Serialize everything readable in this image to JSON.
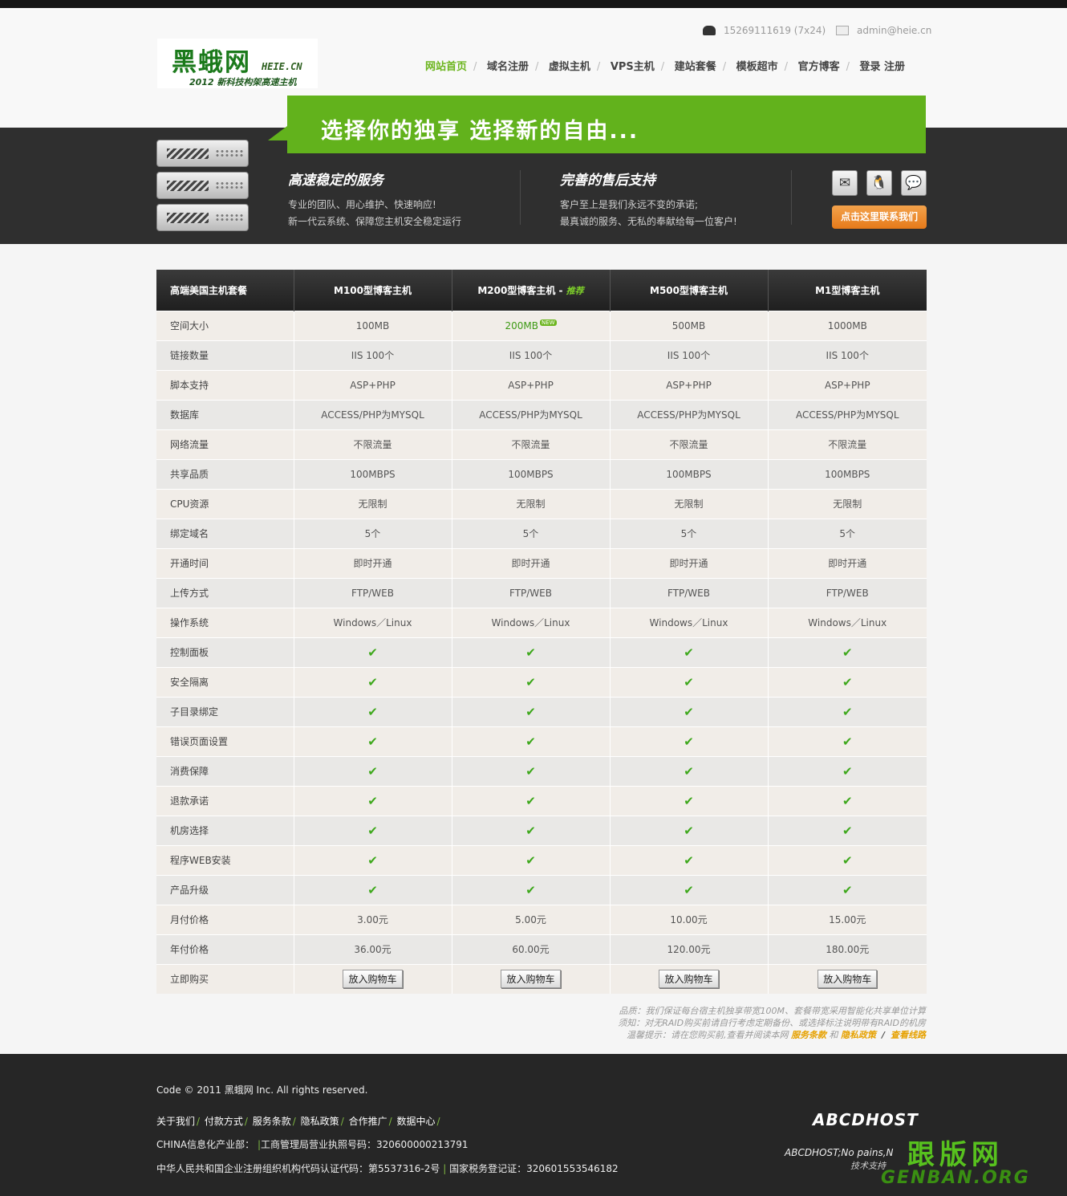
{
  "header": {
    "logo": {
      "title": "黑蛾网",
      "domain": "HEIE.CN",
      "tagline": "2012 新科技构架高速主机"
    },
    "phone": "15269111619 (7x24)",
    "email": "admin@heie.cn",
    "nav": [
      "网站首页",
      "域名注册",
      "虚拟主机",
      "VPS主机",
      "建站套餐",
      "模板超市",
      "官方博客",
      "登录 注册"
    ]
  },
  "banner": {
    "slogan": "选择你的独享 选择新的自由...",
    "features": [
      {
        "title": "高速稳定的服务",
        "lines": [
          "专业的团队、用心维护、快速响应!",
          "新一代云系统、保障您主机安全稳定运行"
        ]
      },
      {
        "title": "完善的售后支持",
        "lines": [
          "客户至上是我们永远不变的承诺;",
          "最真诚的服务、无私的奉献给每一位客户!"
        ]
      }
    ],
    "contact_button": "点击这里联系我们",
    "icons": [
      "mail-icon",
      "qq-icon",
      "chat-icon"
    ]
  },
  "table": {
    "headers": [
      "高端美国主机套餐",
      "M100型博客主机",
      "M200型博客主机",
      "M500型博客主机",
      "M1型博客主机"
    ],
    "recommend_tag": "推荐",
    "new_badge": "NEW",
    "rows": [
      [
        "空间大小",
        "100MB",
        "200MB",
        "500MB",
        "1000MB"
      ],
      [
        "链接数量",
        "IIS 100个",
        "IIS 100个",
        "IIS 100个",
        "IIS 100个"
      ],
      [
        "脚本支持",
        "ASP+PHP",
        "ASP+PHP",
        "ASP+PHP",
        "ASP+PHP"
      ],
      [
        "数据库",
        "ACCESS/PHP为MYSQL",
        "ACCESS/PHP为MYSQL",
        "ACCESS/PHP为MYSQL",
        "ACCESS/PHP为MYSQL"
      ],
      [
        "网络流量",
        "不限流量",
        "不限流量",
        "不限流量",
        "不限流量"
      ],
      [
        "共享品质",
        "100MBPS",
        "100MBPS",
        "100MBPS",
        "100MBPS"
      ],
      [
        "CPU资源",
        "无限制",
        "无限制",
        "无限制",
        "无限制"
      ],
      [
        "绑定域名",
        "5个",
        "5个",
        "5个",
        "5个"
      ],
      [
        "开通时间",
        "即时开通",
        "即时开通",
        "即时开通",
        "即时开通"
      ],
      [
        "上传方式",
        "FTP/WEB",
        "FTP/WEB",
        "FTP/WEB",
        "FTP/WEB"
      ],
      [
        "操作系统",
        "Windows／Linux",
        "Windows／Linux",
        "Windows／Linux",
        "Windows／Linux"
      ],
      [
        "控制面板",
        "✔",
        "✔",
        "✔",
        "✔"
      ],
      [
        "安全隔离",
        "✔",
        "✔",
        "✔",
        "✔"
      ],
      [
        "子目录绑定",
        "✔",
        "✔",
        "✔",
        "✔"
      ],
      [
        "错误页面设置",
        "✔",
        "✔",
        "✔",
        "✔"
      ],
      [
        "消费保障",
        "✔",
        "✔",
        "✔",
        "✔"
      ],
      [
        "退款承诺",
        "✔",
        "✔",
        "✔",
        "✔"
      ],
      [
        "机房选择",
        "✔",
        "✔",
        "✔",
        "✔"
      ],
      [
        "程序WEB安装",
        "✔",
        "✔",
        "✔",
        "✔"
      ],
      [
        "产品升级",
        "✔",
        "✔",
        "✔",
        "✔"
      ],
      [
        "月付价格",
        "3.00元",
        "5.00元",
        "10.00元",
        "15.00元"
      ],
      [
        "年付价格",
        "36.00元",
        "60.00元",
        "120.00元",
        "180.00元"
      ]
    ],
    "buy_label": "立即购买",
    "buy_button": "放入购物车"
  },
  "notes": {
    "line1": "品质：我们保证每台宿主机独享带宽100M、套餐带宽采用智能化共享单位计算",
    "line2": "须知：对无RAID购买前请自行考虑定期备份、或选择标注说明带有RAID的机房",
    "line3_prefix": "温馨提示：请在您购买前,查看并阅读本网",
    "link_terms": "服务条款",
    "and": "和",
    "link_privacy": "隐私政策",
    "slash": "/",
    "link_lines": "查看线路"
  },
  "footer": {
    "copyright": "Code © 2011 黑蛾网 Inc. All rights reserved.",
    "links": [
      "关于我们",
      "付款方式",
      "服务条款",
      "隐私政策",
      "合作推广",
      "数据中心"
    ],
    "line_industry": "CHINA信息化产业部：",
    "line_license": "工商管理局营业执照号码：320600000213791",
    "line_org": "中华人民共和国企业注册组织机构代码认证代码：第5537316-2号",
    "line_tax": "国家税务登记证：320601553546182",
    "brand": "ABCDHOST",
    "brand_text": "ABCDHOST;No pains,N",
    "brand_sub": "技术支持",
    "watermark": "跟版网",
    "watermark_domain": "GENBAN.ORG"
  }
}
